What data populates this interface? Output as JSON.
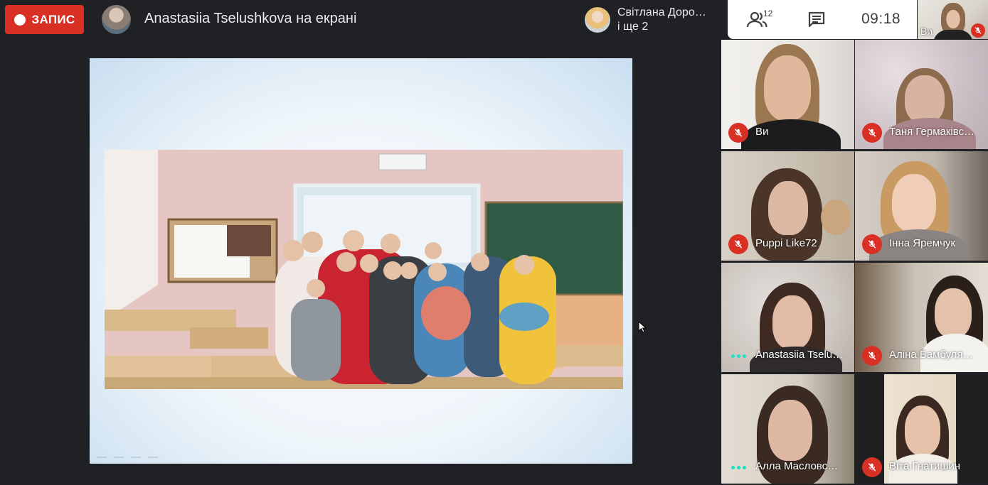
{
  "record": {
    "label": "ЗАПИС"
  },
  "presenter": {
    "title": "Anastasiia Tselushkova на екрані"
  },
  "speaker": {
    "line1": "Світлана Доро…",
    "line2": "і ще 2"
  },
  "controls": {
    "people_count": "12",
    "time": "09:18"
  },
  "self_view": {
    "label": "Ви"
  },
  "colors": {
    "record_red": "#d93025",
    "background": "#202124",
    "talk_indicator": "#1fe0c0"
  },
  "participants": [
    {
      "name": "Ви",
      "muted": true
    },
    {
      "name": "Таня Гермаківс…",
      "muted": true
    },
    {
      "name": "Puppi Like72",
      "muted": true
    },
    {
      "name": "Інна Яремчук",
      "muted": true
    },
    {
      "name": "Anastasiia Tselu…",
      "muted": false,
      "speaking": true
    },
    {
      "name": "Аліна Бамбуля…",
      "muted": true
    },
    {
      "name": "Алла Масловс…",
      "muted": false,
      "speaking": true
    },
    {
      "name": "Віта Гнатишин",
      "muted": true
    }
  ]
}
